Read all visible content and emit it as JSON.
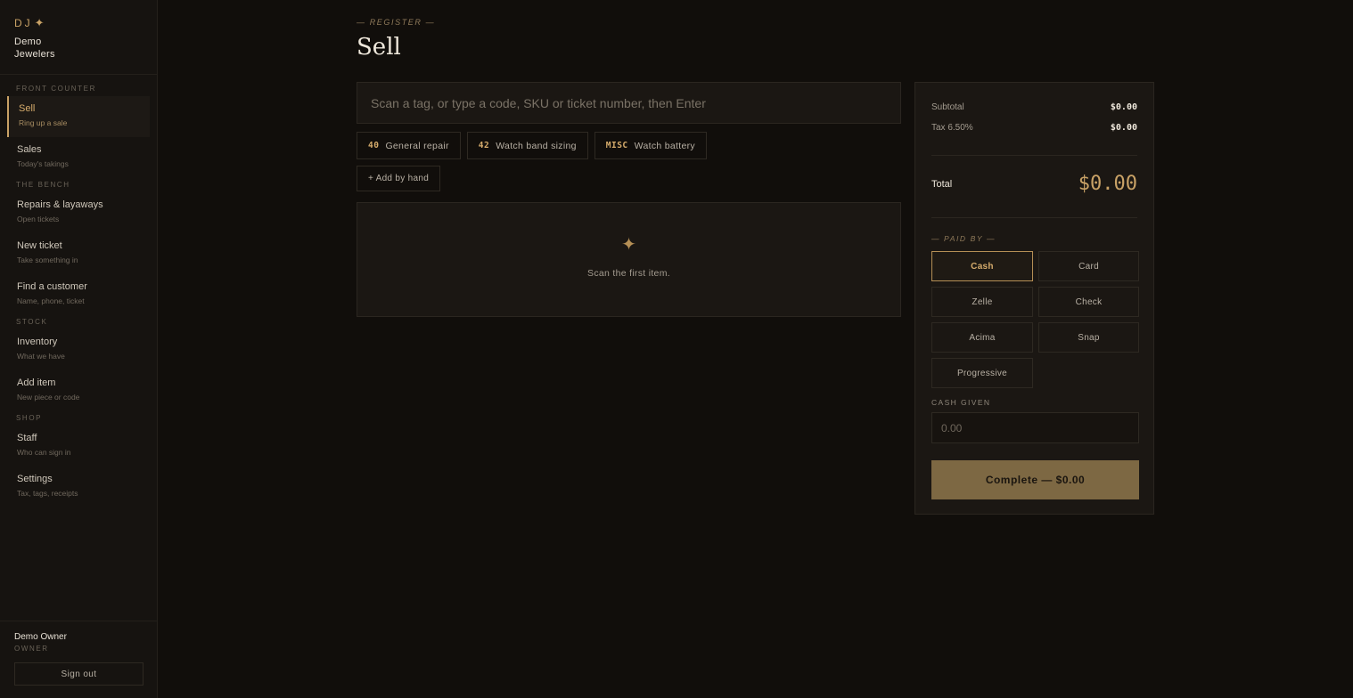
{
  "brand": {
    "mark": "DJ",
    "name_line1": "Demo",
    "name_line2": "Jewelers"
  },
  "sidebar": {
    "sections": [
      {
        "label": "FRONT COUNTER",
        "items": [
          {
            "title": "Sell",
            "sub": "Ring up a sale",
            "active": true
          },
          {
            "title": "Sales",
            "sub": "Today's takings"
          }
        ]
      },
      {
        "label": "THE BENCH",
        "items": [
          {
            "title": "Repairs & layaways",
            "sub": "Open tickets"
          },
          {
            "title": "New ticket",
            "sub": "Take something in"
          },
          {
            "title": "Find a customer",
            "sub": "Name, phone, ticket"
          }
        ]
      },
      {
        "label": "STOCK",
        "items": [
          {
            "title": "Inventory",
            "sub": "What we have"
          },
          {
            "title": "Add item",
            "sub": "New piece or code"
          }
        ]
      },
      {
        "label": "SHOP",
        "items": [
          {
            "title": "Staff",
            "sub": "Who can sign in"
          },
          {
            "title": "Settings",
            "sub": "Tax, tags, receipts"
          }
        ]
      }
    ],
    "user": {
      "name": "Demo Owner",
      "role": "OWNER",
      "signout_label": "Sign out"
    }
  },
  "header": {
    "kicker": "— REGISTER —",
    "title": "Sell"
  },
  "scan": {
    "placeholder": "Scan a tag, or type a code, SKU or ticket number, then Enter"
  },
  "quick_items": [
    {
      "code": "40",
      "label": "General repair"
    },
    {
      "code": "42",
      "label": "Watch band sizing"
    },
    {
      "code": "MISC",
      "label": "Watch battery"
    }
  ],
  "add_by_hand_label": "+ Add by hand",
  "cart": {
    "empty_message": "Scan the first item."
  },
  "totals": {
    "subtotal_label": "Subtotal",
    "subtotal_value": "$0.00",
    "tax_label": "Tax 6.50%",
    "tax_value": "$0.00",
    "total_label": "Total",
    "total_value": "$0.00"
  },
  "payment": {
    "heading": "— PAID BY —",
    "methods": [
      "Cash",
      "Card",
      "Zelle",
      "Check",
      "Acima",
      "Snap",
      "Progressive"
    ],
    "selected": "Cash",
    "cash_label": "CASH GIVEN",
    "cash_placeholder": "0.00",
    "complete_label": "Complete — $0.00"
  },
  "colors": {
    "accent": "#c9a266",
    "background": "#110e0b",
    "panel": "#1b1713"
  }
}
